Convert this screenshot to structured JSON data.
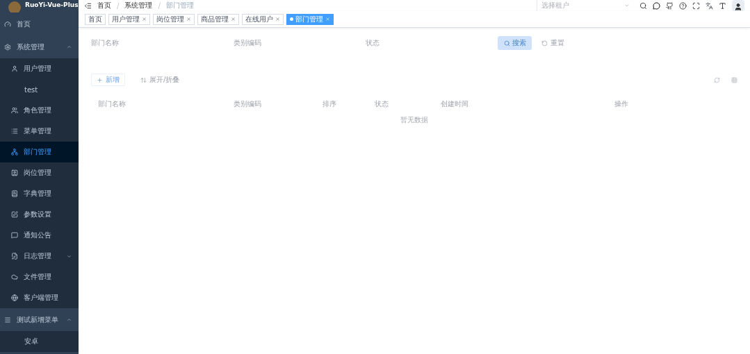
{
  "sidebar": {
    "logo_text": "RuoYi-Vue-Plus",
    "items": [
      {
        "label": "首页",
        "selected": false
      },
      {
        "label": "系统管理",
        "expanded": true,
        "selected": false,
        "children": [
          {
            "label": "用户管理",
            "selected": false
          },
          {
            "label": "test",
            "selected": false
          },
          {
            "label": "角色管理",
            "selected": false
          },
          {
            "label": "菜单管理",
            "selected": false
          },
          {
            "label": "部门管理",
            "selected": true
          },
          {
            "label": "岗位管理",
            "selected": false
          },
          {
            "label": "字典管理",
            "selected": false
          },
          {
            "label": "参数设置",
            "selected": false
          },
          {
            "label": "通知公告",
            "selected": false
          },
          {
            "label": "日志管理",
            "expanded": false,
            "selected": false
          },
          {
            "label": "文件管理",
            "selected": false
          },
          {
            "label": "客户端管理",
            "selected": false
          }
        ]
      },
      {
        "label": "测试新增菜单",
        "expanded": true,
        "selected": false,
        "children": [
          {
            "label": "安卓",
            "selected": false
          }
        ]
      }
    ]
  },
  "navbar": {
    "breadcrumb": [
      "首页",
      "系统管理",
      "部门管理"
    ],
    "separator": "/",
    "tenant_select": {
      "placeholder": "选择租户"
    }
  },
  "tags": [
    {
      "label": "首页",
      "closable": false,
      "selected": false
    },
    {
      "label": "用户管理",
      "closable": true,
      "selected": false
    },
    {
      "label": "岗位管理",
      "closable": true,
      "selected": false
    },
    {
      "label": "商品管理",
      "closable": true,
      "selected": false
    },
    {
      "label": "在线用户",
      "closable": true,
      "selected": false
    },
    {
      "label": "部门管理",
      "closable": true,
      "selected": true
    }
  ],
  "search_form": {
    "fields": [
      "部门名称",
      "类别编码",
      "状态"
    ],
    "search_button": "搜索",
    "reset_button": "重置"
  },
  "toolbar": {
    "add_button": "新增",
    "expand_button": "展开/折叠"
  },
  "table": {
    "columns": [
      "部门名称",
      "类别编码",
      "排序",
      "状态",
      "创建时间",
      "操作"
    ],
    "empty_text": "暂无数据"
  }
}
